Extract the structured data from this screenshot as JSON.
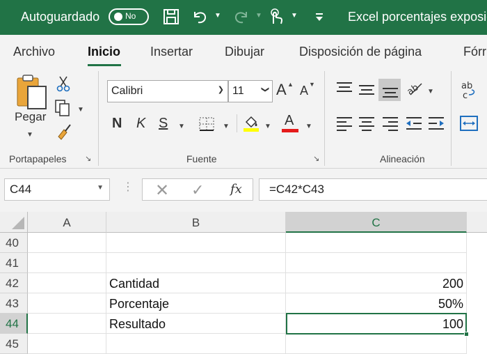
{
  "titlebar": {
    "autosave_label": "Autoguardado",
    "autosave_state": "No",
    "document_title": "Excel porcentajes exposici"
  },
  "tabs": [
    {
      "label": "Archivo",
      "active": false
    },
    {
      "label": "Inicio",
      "active": true
    },
    {
      "label": "Insertar",
      "active": false
    },
    {
      "label": "Dibujar",
      "active": false
    },
    {
      "label": "Disposición de página",
      "active": false
    },
    {
      "label": "Fórr",
      "active": false
    }
  ],
  "ribbon": {
    "clipboard": {
      "paste_label": "Pegar",
      "group_label": "Portapapeles"
    },
    "font": {
      "font_name": "Calibri",
      "font_size": "11",
      "bold": "N",
      "italic": "K",
      "underline": "S",
      "font_color_glyph": "A",
      "grow": "A",
      "shrink": "A",
      "highlight_color": "#ffff00",
      "font_color": "#e51b1b",
      "group_label": "Fuente"
    },
    "alignment": {
      "group_label": "Alineación"
    }
  },
  "formula_bar": {
    "name_box": "C44",
    "cancel": "✕",
    "enter": "✓",
    "fx": "fx",
    "formula": "=C42*C43"
  },
  "grid": {
    "columns": [
      "A",
      "B",
      "C"
    ],
    "selected_column": "C",
    "selected_row": "44",
    "rows": [
      {
        "num": "40",
        "a": "",
        "b": "",
        "c": ""
      },
      {
        "num": "41",
        "a": "",
        "b": "",
        "c": ""
      },
      {
        "num": "42",
        "a": "",
        "b": "Cantidad",
        "c": "200"
      },
      {
        "num": "43",
        "a": "",
        "b": "Porcentaje",
        "c": "50%"
      },
      {
        "num": "44",
        "a": "",
        "b": "Resultado",
        "c": "100"
      },
      {
        "num": "45",
        "a": "",
        "b": "",
        "c": ""
      }
    ]
  },
  "colors": {
    "accent": "#217346"
  }
}
